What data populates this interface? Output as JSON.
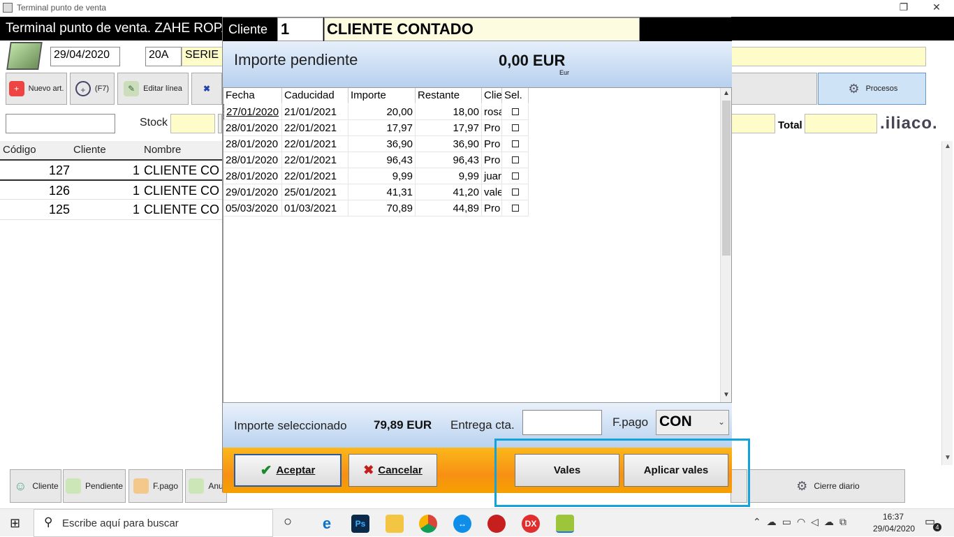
{
  "window": {
    "title": "Terminal punto de venta",
    "restore": "❐",
    "close": "✕"
  },
  "app": {
    "title": "Terminal punto de venta. ZAHE ROPA",
    "date": "29/04/2020",
    "serie_code": "20A",
    "serie_label": "SERIE",
    "stock_label": "Stock",
    "total_label": "Total",
    "logo": ".iliaco.",
    "toolbar": {
      "nuevo": "Nuevo art.",
      "f7": "(F7)",
      "editar": "Editar línea",
      "procesos": "Procesos"
    },
    "grid": {
      "headers": [
        "Código",
        "Cliente",
        "Nombre"
      ],
      "rows": [
        {
          "codigo": "127",
          "cliente": "1",
          "nombre": "CLIENTE CO"
        },
        {
          "codigo": "126",
          "cliente": "1",
          "nombre": "CLIENTE CO"
        },
        {
          "codigo": "125",
          "cliente": "1",
          "nombre": "CLIENTE CO"
        }
      ]
    },
    "bottom": {
      "cliente": "Cliente",
      "pendiente": "Pendiente",
      "fpago": "F.pago",
      "anular": "Anu",
      "cierre": "Cierre diario"
    }
  },
  "modal": {
    "cliente_label": "Cliente",
    "cliente_code": "1",
    "cliente_name": "CLIENTE CONTADO",
    "pendiente_label": "Importe pendiente",
    "pendiente_value": "0,00 EUR",
    "pendiente_unit": "Eur",
    "columns": [
      "Fecha",
      "Caducidad",
      "Importe",
      "Restante",
      "Clie",
      "Sel."
    ],
    "rows": [
      {
        "fecha": "27/01/2020",
        "caducidad": "21/01/2021",
        "importe": "20,00",
        "restante": "18,00",
        "cliente": "rosa"
      },
      {
        "fecha": "28/01/2020",
        "caducidad": "22/01/2021",
        "importe": "17,97",
        "restante": "17,97",
        "cliente": "Pro"
      },
      {
        "fecha": "28/01/2020",
        "caducidad": "22/01/2021",
        "importe": "36,90",
        "restante": "36,90",
        "cliente": "Pro"
      },
      {
        "fecha": "28/01/2020",
        "caducidad": "22/01/2021",
        "importe": "96,43",
        "restante": "96,43",
        "cliente": "Pro"
      },
      {
        "fecha": "28/01/2020",
        "caducidad": "22/01/2021",
        "importe": "9,99",
        "restante": "9,99",
        "cliente": "juan"
      },
      {
        "fecha": "29/01/2020",
        "caducidad": "25/01/2021",
        "importe": "41,31",
        "restante": "41,20",
        "cliente": "vale"
      },
      {
        "fecha": "05/03/2020",
        "caducidad": "01/03/2021",
        "importe": "70,89",
        "restante": "44,89",
        "cliente": "Pro"
      }
    ],
    "seleccionado_label": "Importe seleccionado",
    "seleccionado_value": "79,89 EUR",
    "entrega_label": "Entrega cta.",
    "entrega_value": "",
    "fpago_label": "F.pago",
    "fpago_value": "CON",
    "buttons": {
      "aceptar": "Aceptar",
      "cancelar": "Cancelar",
      "vales": "Vales",
      "aplicar": "Aplicar vales"
    }
  },
  "taskbar": {
    "search_placeholder": "Escribe aquí para buscar",
    "time": "16:37",
    "date": "29/04/2020",
    "notifications": "4"
  }
}
